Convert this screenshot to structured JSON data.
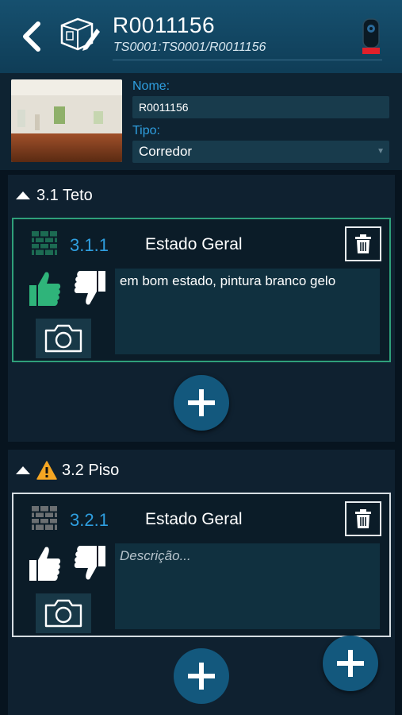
{
  "header": {
    "title": "R0011156",
    "subtitle": "TS0001:TS0001/R0011156",
    "icons": [
      "back-arrow-icon",
      "room-edit-icon",
      "device-icon"
    ]
  },
  "property": {
    "name_label": "Nome:",
    "name_value": "R0011156",
    "type_label": "Tipo:",
    "type_value": "Corredor"
  },
  "sections": [
    {
      "title": "3.1 Teto",
      "warning": false,
      "items": [
        {
          "code": "3.1.1",
          "name": "Estado Geral",
          "rating": "up",
          "description": "em bom estado, pintura branco gelo",
          "placeholder": ""
        }
      ]
    },
    {
      "title": "3.2 Piso",
      "warning": true,
      "items": [
        {
          "code": "3.2.1",
          "name": "Estado Geral",
          "rating": "none",
          "description": "",
          "placeholder": "Descrição..."
        }
      ]
    }
  ],
  "colors": {
    "header": "#16506f",
    "accent_blue": "#2f9fe0",
    "thumb_up_active": "#2fb47a",
    "card_border_active": "#2fa07a",
    "fab": "#13587d",
    "warning": "#f5a623"
  }
}
